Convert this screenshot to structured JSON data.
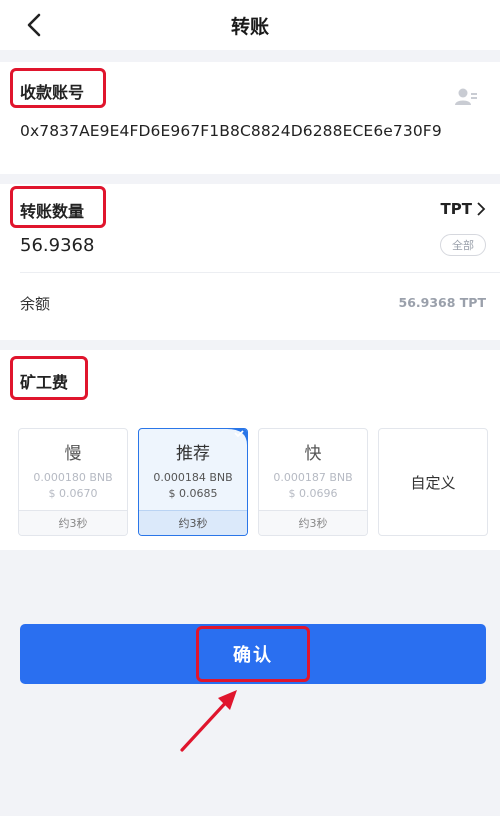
{
  "header": {
    "title": "转账"
  },
  "recipient": {
    "label": "收款账号",
    "address": "0x7837AE9E4FD6E967F1B8C8824D6288ECE6e730F9"
  },
  "amount": {
    "label": "转账数量",
    "token": "TPT",
    "value": "56.9368",
    "all_label": "全部"
  },
  "balance": {
    "label": "余额",
    "value": "56.9368 TPT"
  },
  "fee": {
    "label": "矿工费",
    "options": [
      {
        "name": "慢",
        "bnb": "0.000180 BNB",
        "usd": "$ 0.0670",
        "time": "约3秒",
        "selected": false
      },
      {
        "name": "推荐",
        "bnb": "0.000184 BNB",
        "usd": "$ 0.0685",
        "time": "约3秒",
        "selected": true
      },
      {
        "name": "快",
        "bnb": "0.000187 BNB",
        "usd": "$ 0.0696",
        "time": "约3秒",
        "selected": false
      }
    ],
    "custom_label": "自定义"
  },
  "confirm": {
    "label": "确认"
  },
  "colors": {
    "primary": "#2a6ff0",
    "highlight": "#e0152d",
    "background": "#f2f3f7"
  }
}
